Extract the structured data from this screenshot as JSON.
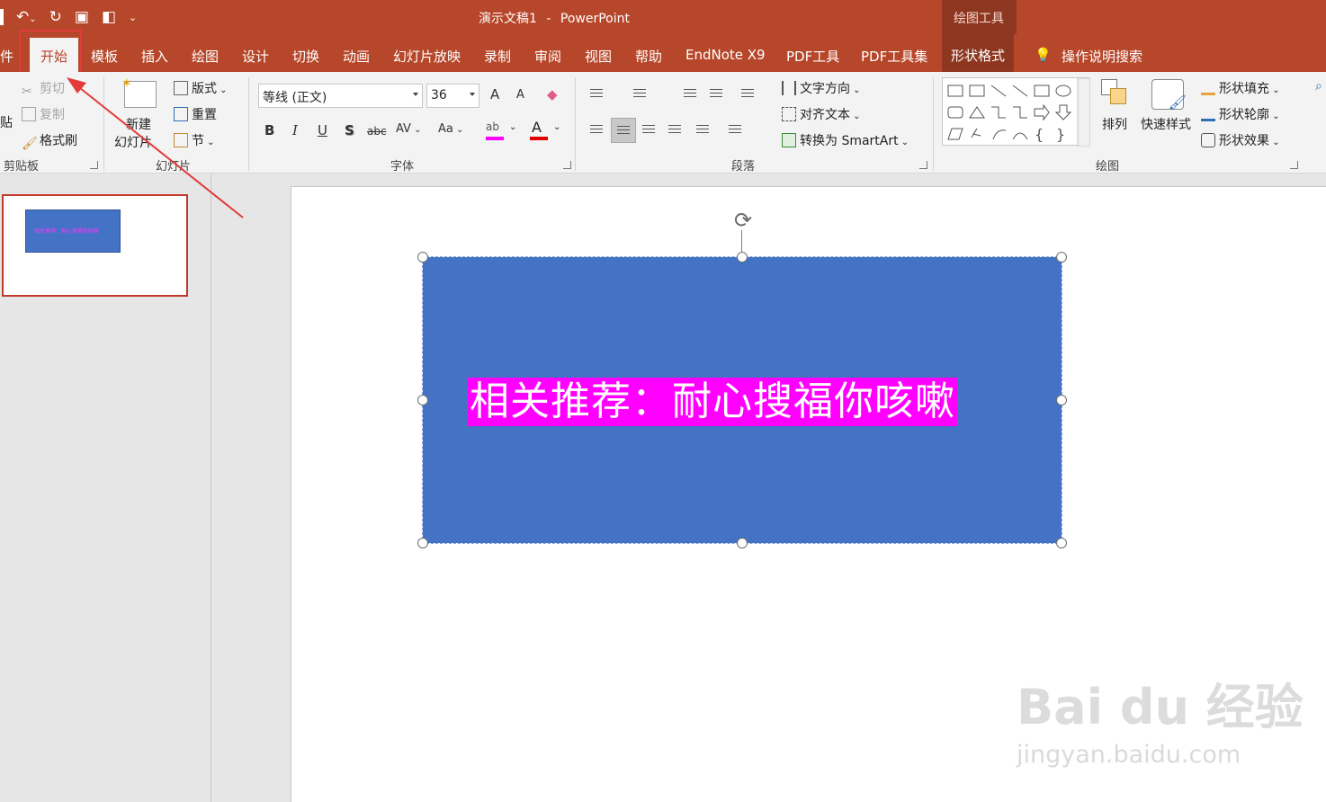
{
  "window": {
    "doc_title": "演示文稿1",
    "app_name": "PowerPoint",
    "title_separator": "-",
    "context_tool_label": "绘图工具"
  },
  "qat": {
    "undo_icon": "undo-icon",
    "redo_icon": "redo-icon",
    "present_icon": "present-icon",
    "layout_icon": "layout-icon",
    "customize_icon": "customize-icon"
  },
  "tabs": {
    "file_partial": "件",
    "home": "开始",
    "templates": "模板",
    "insert": "插入",
    "draw": "绘图",
    "design": "设计",
    "transitions": "切换",
    "animations": "动画",
    "slideshow": "幻灯片放映",
    "record": "录制",
    "review": "审阅",
    "view": "视图",
    "help": "帮助",
    "endnote": "EndNote X9",
    "pdf_tools": "PDF工具",
    "pdf_toolset": "PDF工具集",
    "shape_format": "形状格式",
    "tell_me": "操作说明搜索"
  },
  "clipboard": {
    "paste_partial": "贴",
    "cut": "剪切",
    "copy": "复制",
    "format_painter": "格式刷",
    "group_label": "剪贴板"
  },
  "slides": {
    "new_slide_line1": "新建",
    "new_slide_line2": "幻灯片",
    "layout": "版式",
    "reset": "重置",
    "section": "节",
    "group_label": "幻灯片"
  },
  "font": {
    "font_name": "等线 (正文)",
    "font_size": "36",
    "bold": "B",
    "italic": "I",
    "underline": "U",
    "shadow": "S",
    "strikethrough": "abc",
    "char_spacing": "AV",
    "change_case": "Aa",
    "grow": "A",
    "shrink": "A",
    "group_label": "字体"
  },
  "paragraph": {
    "text_direction": "文字方向",
    "align_text": "对齐文本",
    "convert_smartart": "转换为 SmartArt",
    "group_label": "段落"
  },
  "drawing": {
    "arrange": "排列",
    "quick_styles": "快速样式",
    "shape_fill": "形状填充",
    "shape_outline": "形状轮廓",
    "shape_effects": "形状效果",
    "group_label": "绘图"
  },
  "slide": {
    "text": "相关推荐：耐心搜福你咳嗽",
    "thumb_text": "相关推荐：耐心搜福你咳嗽"
  },
  "colors": {
    "accent": "#b7472a",
    "shape_fill": "#4472c4",
    "text_highlight": "#ff00ff",
    "annotation": "#e23b3b"
  },
  "watermark": {
    "logo": "Bai du 经验",
    "url": "jingyan.baidu.com"
  }
}
